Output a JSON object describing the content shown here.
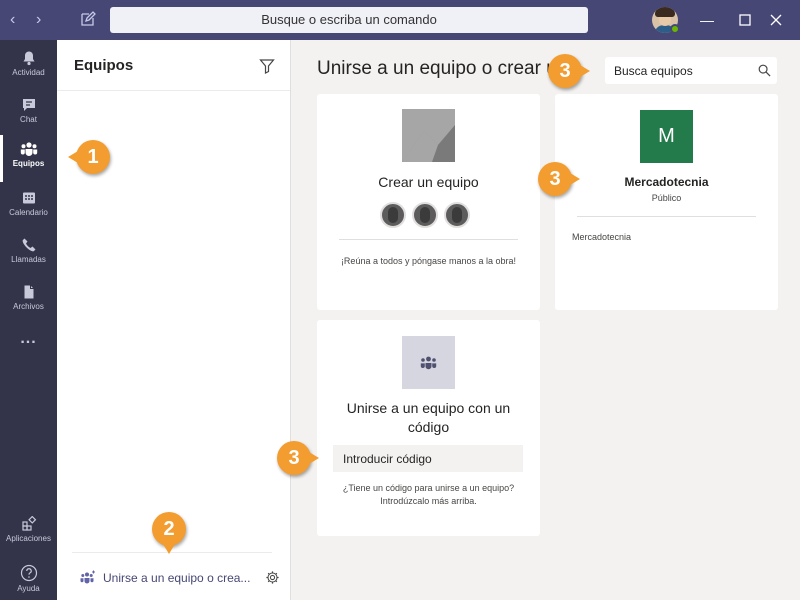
{
  "titlebar": {
    "back_icon": "chevron-left-icon",
    "forward_icon": "chevron-right-icon",
    "compose_icon": "compose-icon",
    "search_placeholder": "Busque o escriba un comando",
    "presence_color": "#6bb700",
    "background_color": "#464775"
  },
  "rail": {
    "items": [
      {
        "icon": "bell-icon",
        "label": "Actividad"
      },
      {
        "icon": "chat-icon",
        "label": "Chat"
      },
      {
        "icon": "teams-icon",
        "label": "Equipos"
      },
      {
        "icon": "calendar-icon",
        "label": "Calendario"
      },
      {
        "icon": "phone-icon",
        "label": "Llamadas"
      },
      {
        "icon": "file-icon",
        "label": "Archivos"
      },
      {
        "icon": "more-icon",
        "label": "..."
      }
    ],
    "bottom_items": [
      {
        "icon": "apps-icon",
        "label": "Aplicaciones"
      },
      {
        "icon": "help-icon",
        "label": "Ayuda"
      }
    ],
    "active": "Equipos"
  },
  "panel": {
    "title": "Equipos",
    "join_label": "Unirse a un equipo o crea..."
  },
  "main": {
    "title": "Unirse a un equipo o crear uno",
    "search_placeholder": "Busca equipos",
    "create_card": {
      "heading": "Crear un equipo",
      "subtext": "¡Reúna a todos y póngase manos a la obra!"
    },
    "team_card": {
      "logo_letter": "M",
      "logo_color": "#237b4b",
      "name": "Mercadotecnia",
      "type": "Público",
      "description": "Mercadotecnia"
    },
    "code_card": {
      "heading": "Unirse a un equipo con un código",
      "input_placeholder": "Introducir código",
      "subtext": "¿Tiene un código para unirse a un equipo? Introdúzcalo más arriba."
    }
  },
  "callouts": {
    "one": "1",
    "two": "2",
    "three_search": "3",
    "three_team": "3",
    "three_code": "3",
    "color": "#f39c2f"
  }
}
